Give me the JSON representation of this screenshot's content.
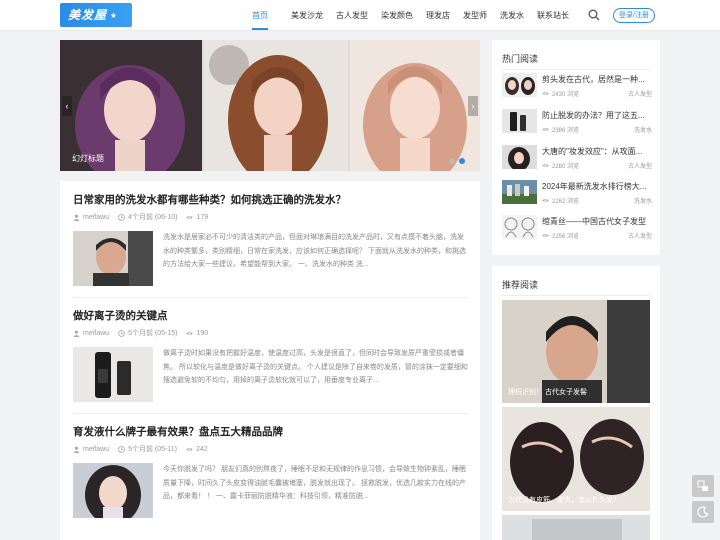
{
  "header": {
    "logo_text": "美发屋",
    "nav": [
      "首页",
      "美发沙龙",
      "古人发型",
      "染发颜色",
      "理发店",
      "发型师",
      "洗发水",
      "联系站长"
    ],
    "login_label": "登录/注册"
  },
  "slider": {
    "caption": "幻灯标题",
    "prev": "‹",
    "next": "›"
  },
  "articles": [
    {
      "title": "日常家用的洗发水都有哪些种类？如何挑选正确的洗发水？",
      "author": "meifawu",
      "time": "4个月前 (06-10)",
      "views": "179",
      "excerpt": "洗发水是居家必不可少的清洁类的产品，但面对琳琅满目的洗发产品时，又有点摸不着头脑，洗发水的种类繁多，类别精细，日常在家洗发，应该如何正确选择呢？ 下面就从洗发水的种类，和挑选的方法给大家一些建议，希望能帮到大家。 一、洗发水的种类 洗..."
    },
    {
      "title": "做好离子烫的关键点",
      "author": "meifawu",
      "time": "5个月前 (05-15)",
      "views": "190",
      "excerpt": "做离子烫时如果没有把握好温度，使温度过高，头发是很直了，但同时会导致发质严重受损或者僵焦。 所以软化与温度是做好离子烫的关键点。 个人建议是除了自来卷的发质，冒的涂抹一定要细和搜选避免软的不均匀，用掉的离子烫软化就可以了，用垂度专业离子..."
    },
    {
      "title": "育发液什么牌子最有效果？盘点五大精品品牌",
      "author": "meifawu",
      "time": "5个月前 (05-11)",
      "views": "242",
      "excerpt": "今天你脱发了吗？ 朋友们真的别熬夜了，睡眠不足和无规律的作息习惯，会导致生物钟紊乱，睡眠质量下降，时间久了头皮变得油腻毛囊被堵塞，脱发就出现了。 拯救脱发，优选几款实力在线的产品，都来看！ ！ 一、露卡菲丽防脱精华液：科技引领，精准防脱..."
    }
  ],
  "hot": {
    "title": "热门阅读",
    "items": [
      {
        "title": "剪头发在古代，居然是一种...",
        "views": "2430 浏览",
        "cat": "古人发型"
      },
      {
        "title": "防止脱发的办法？用了这五...",
        "views": "2386 浏览",
        "cat": "洗发水"
      },
      {
        "title": "大唐的\"妆发效应\"：从攻面...",
        "views": "2280 浏览",
        "cat": "古人发型"
      },
      {
        "title": "2024年最新洗发水排行榜大...",
        "views": "2262 浏览",
        "cat": "洗发水"
      },
      {
        "title": "绾青丝——中国古代女子发型",
        "views": "2256 浏览",
        "cat": "古人发型"
      }
    ]
  },
  "recommend": {
    "title": "推荐阅读",
    "items": [
      {
        "caption": "理短识别！ 古代女子发髻"
      },
      {
        "caption": "古代没有皮筋、发夹，怎么扎头发？"
      }
    ]
  },
  "colors": {
    "accent": "#2a8be8",
    "background": "#f1f2f3"
  }
}
